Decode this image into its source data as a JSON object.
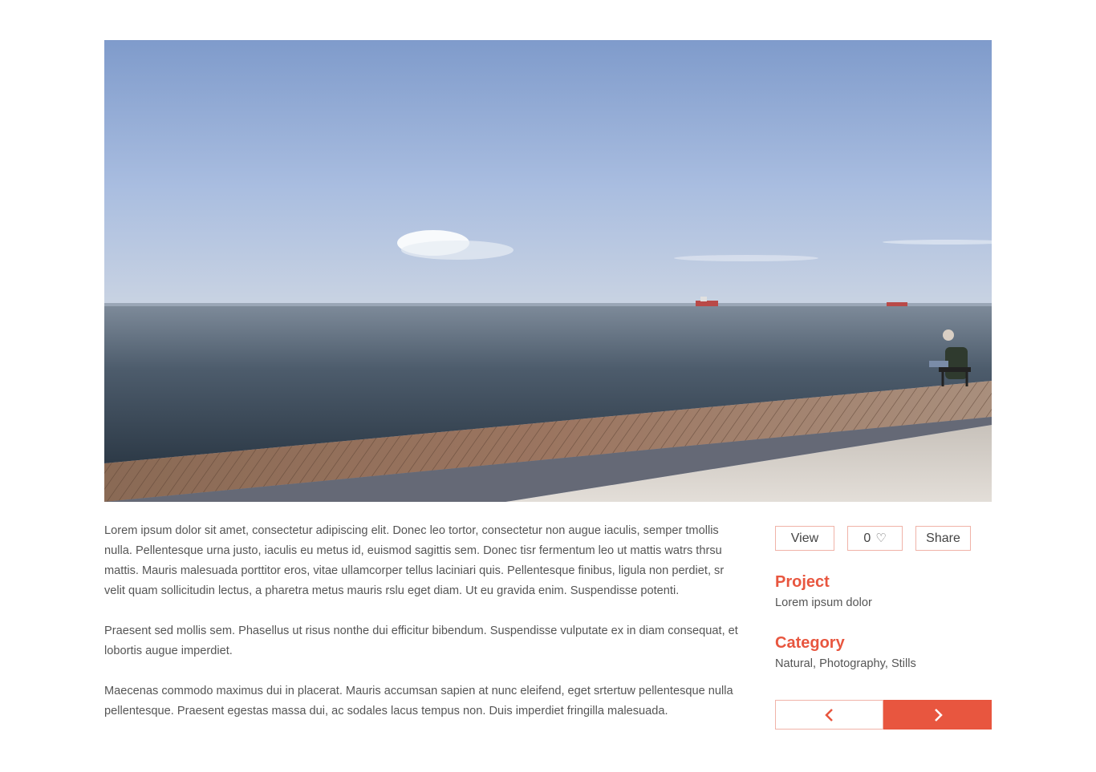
{
  "hero": {
    "alt": "Seaside boardwalk with a man fishing"
  },
  "description": {
    "paragraphs": [
      "Lorem ipsum dolor sit amet, consectetur adipiscing elit. Donec leo tortor, consectetur non augue iaculis, semper tmollis nulla. Pellentesque urna justo, iaculis eu metus id, euismod sagittis sem. Donec tisr fermentum leo ut mattis watrs thrsu mattis. Mauris malesuada porttitor eros, vitae ullamcorper tellus laciniari quis. Pellentesque finibus, ligula non perdiet, sr velit quam sollicitudin lectus, a pharetra metus mauris rslu eget diam. Ut eu gravida enim. Suspendisse potenti.",
      "Praesent sed mollis sem. Phasellus ut risus nonthe dui efficitur bibendum. Suspendisse vulputate ex in diam consequat, et lobortis augue imperdiet.",
      "Maecenas commodo maximus dui in placerat. Mauris accumsan sapien at nunc eleifend, eget  srtertuw pellentesque nulla pellentesque. Praesent egestas massa dui, ac sodales lacus tempus non. Duis imperdiet fringilla malesuada."
    ]
  },
  "actions": {
    "view_label": "View",
    "like_count": "0",
    "like_icon": "heart-icon",
    "share_label": "Share"
  },
  "project": {
    "title": "Project",
    "value": "Lorem ipsum dolor"
  },
  "category": {
    "title": "Category",
    "value": "Natural, Photography, Stills"
  },
  "pager": {
    "prev_icon": "chevron-left-icon",
    "next_icon": "chevron-right-icon"
  },
  "colors": {
    "accent": "#e8563f",
    "border": "#f0b3a8",
    "text": "#555555"
  }
}
